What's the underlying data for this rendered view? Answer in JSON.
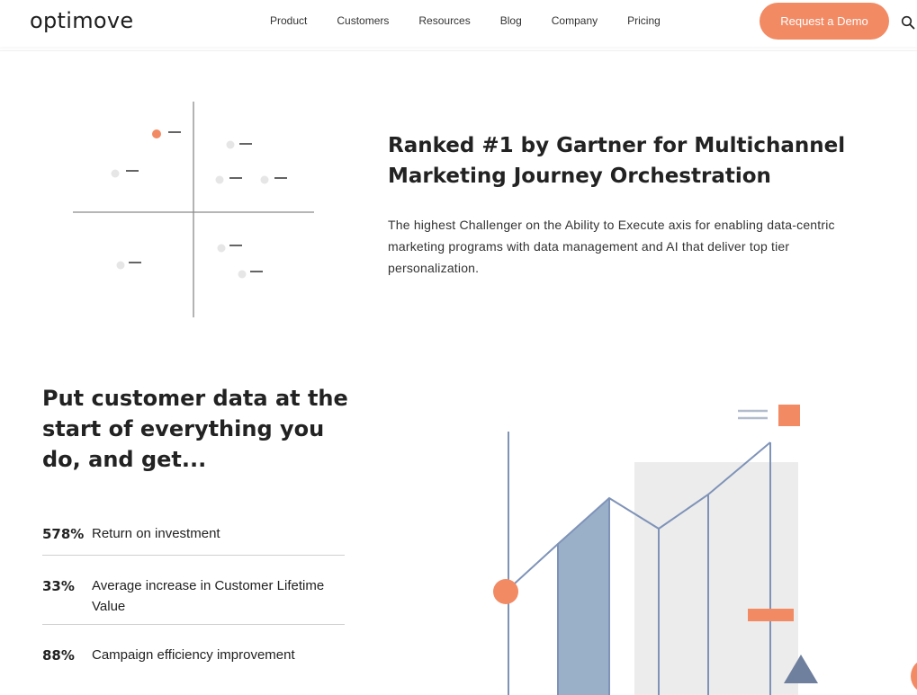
{
  "header": {
    "logo": "optimove",
    "nav": [
      "Product",
      "Customers",
      "Resources",
      "Blog",
      "Company",
      "Pricing"
    ],
    "cta": "Request a Demo"
  },
  "gartner": {
    "title": "Ranked #1 by Gartner for Multichannel Marketing Journey Orchestration",
    "description": "The highest Challenger on the Ability to Execute axis for enabling data-centric marketing programs with data management and AI that deliver top tier personalization."
  },
  "stats": {
    "title": "Put customer data at the start of everything you do, and get...",
    "items": [
      {
        "value": "578%",
        "label": "Return on investment"
      },
      {
        "value": "33%",
        "label": "Average increase in Customer Lifetime Value"
      },
      {
        "value": "88%",
        "label": "Campaign efficiency improvement"
      }
    ]
  },
  "colors": {
    "accent": "#f28a64",
    "slate": "#7f93b8",
    "slate_fill": "#9aafc8",
    "light_gray": "#ececec"
  },
  "icons": {
    "search": "search-icon"
  }
}
